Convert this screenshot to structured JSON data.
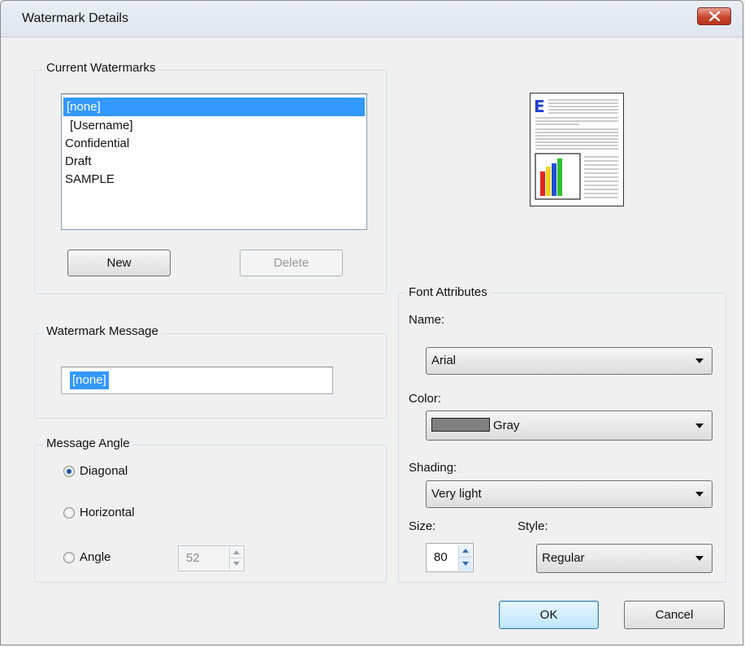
{
  "dialog": {
    "title": "Watermark Details"
  },
  "current_watermarks": {
    "legend": "Current Watermarks",
    "items": [
      {
        "label": "[none]",
        "selected": true
      },
      {
        "label": "[Username]",
        "selected": false
      },
      {
        "label": "Confidential",
        "selected": false
      },
      {
        "label": "Draft",
        "selected": false
      },
      {
        "label": "SAMPLE",
        "selected": false
      }
    ],
    "new_label": "New",
    "delete_label": "Delete"
  },
  "watermark_message": {
    "legend": "Watermark Message",
    "value": "[none]"
  },
  "message_angle": {
    "legend": "Message Angle",
    "options": {
      "diagonal": "Diagonal",
      "horizontal": "Horizontal",
      "angle": "Angle"
    },
    "selected": "Diagonal",
    "angle_value": "52"
  },
  "font_attributes": {
    "legend": "Font Attributes",
    "name_label": "Name:",
    "name_value": "Arial",
    "color_label": "Color:",
    "color_value": "Gray",
    "color_swatch": "#808080",
    "shading_label": "Shading:",
    "shading_value": "Very light",
    "size_label": "Size:",
    "size_value": "80",
    "style_label": "Style:",
    "style_value": "Regular"
  },
  "footer": {
    "ok_label": "OK",
    "cancel_label": "Cancel"
  },
  "preview": {
    "letter": "E",
    "bar_colors": [
      "#e8231b",
      "#f2d21a",
      "#1f4fd8",
      "#2fbf2f"
    ]
  }
}
